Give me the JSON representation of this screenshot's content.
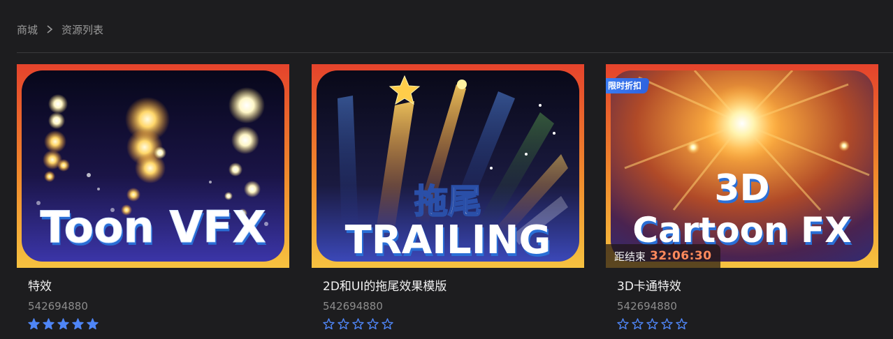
{
  "breadcrumb": {
    "home": "商城",
    "current": "资源列表"
  },
  "colors": {
    "star_active": "#4f86f7",
    "accent_blue": "#3c7ff5",
    "countdown": "#ff8a5c"
  },
  "cards": [
    {
      "title": "特效",
      "id": "542694880",
      "rating": 5,
      "art_text": [
        "Toon VFX"
      ],
      "badge": null,
      "countdown": null
    },
    {
      "title": "2D和UI的拖尾效果模版",
      "id": "542694880",
      "rating": 0,
      "art_text": [
        "拖尾",
        "TRAILING"
      ],
      "badge": null,
      "countdown": null
    },
    {
      "title": "3D卡通特效",
      "id": "542694880",
      "rating": 0,
      "art_text": [
        "3D",
        "Cartoon FX"
      ],
      "badge": "限时折扣",
      "countdown": {
        "label": "距结束",
        "time": "32:06:30"
      }
    }
  ]
}
